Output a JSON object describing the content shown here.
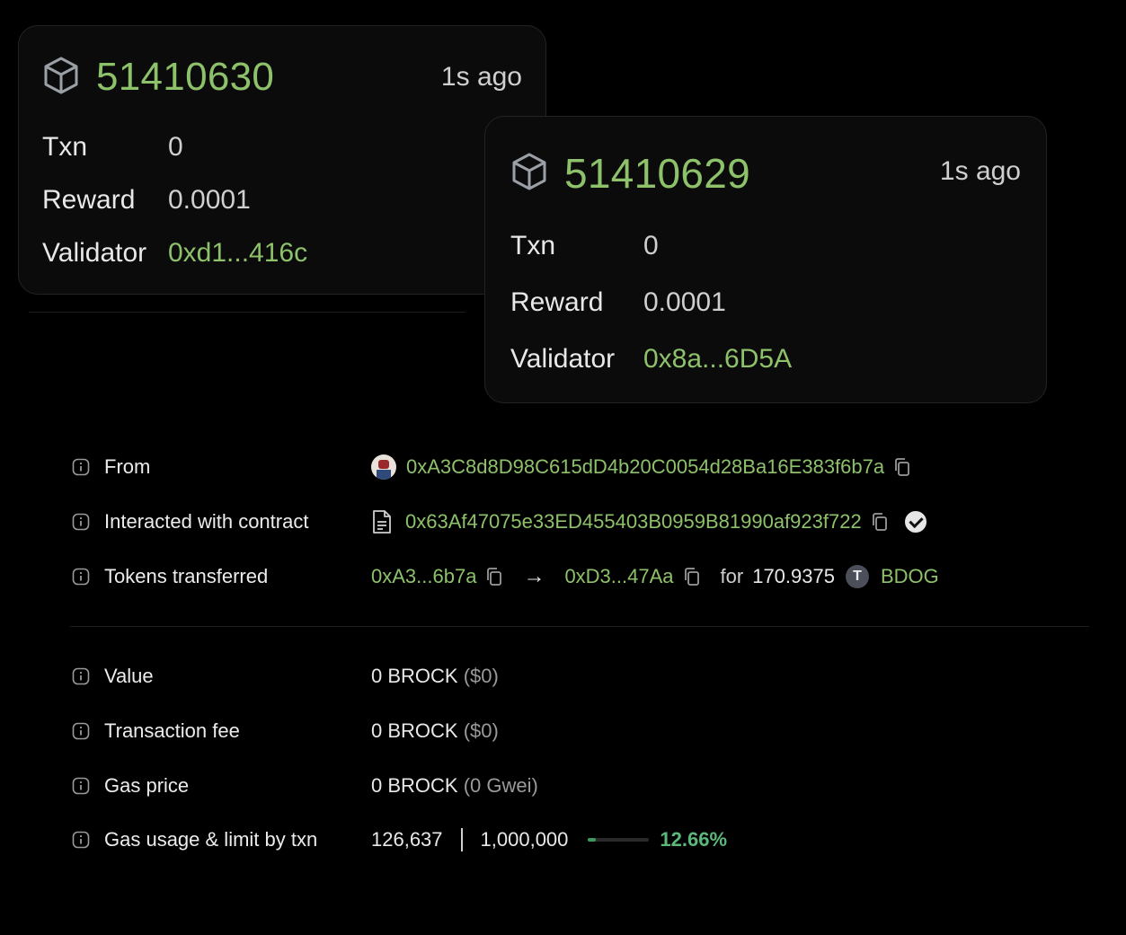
{
  "blocks": [
    {
      "number": "51410630",
      "age": "1s ago",
      "txn_label": "Txn",
      "txn": "0",
      "reward_label": "Reward",
      "reward": "0.0001",
      "validator_label": "Validator",
      "validator": "0xd1...416c"
    },
    {
      "number": "51410629",
      "age": "1s ago",
      "txn_label": "Txn",
      "txn": "0",
      "reward_label": "Reward",
      "reward": "0.0001",
      "validator_label": "Validator",
      "validator": "0x8a...6D5A"
    }
  ],
  "details": {
    "from": {
      "label": "From",
      "address": "0xA3C8d8D98C615dD4b20C0054d28Ba16E383f6b7a"
    },
    "contract": {
      "label": "Interacted with contract",
      "address": "0x63Af47075e33ED455403B0959B81990af923f722"
    },
    "tokens": {
      "label": "Tokens transferred",
      "from": "0xA3...6b7a",
      "to": "0xD3...47Aa",
      "for_label": "for",
      "amount": "170.9375",
      "token_badge": "T",
      "token": "BDOG"
    },
    "value": {
      "label": "Value",
      "amount": "0 BROCK",
      "usd": "($0)"
    },
    "fee": {
      "label": "Transaction fee",
      "amount": "0 BROCK",
      "usd": "($0)"
    },
    "gas_price": {
      "label": "Gas price",
      "amount": "0 BROCK",
      "gwei": "(0 Gwei)"
    },
    "gas_usage": {
      "label": "Gas usage & limit by txn",
      "used": "126,637",
      "limit": "1,000,000",
      "percent": "12.66%",
      "fraction": 0.1266
    }
  },
  "colors": {
    "accent_green": "#8dc16a",
    "bar_green": "#3c9a5f",
    "background": "#000000"
  },
  "icons": [
    "block-icon",
    "info-icon",
    "copy-icon",
    "document-icon",
    "verified-check-icon",
    "arrow-right-icon",
    "avatar"
  ]
}
